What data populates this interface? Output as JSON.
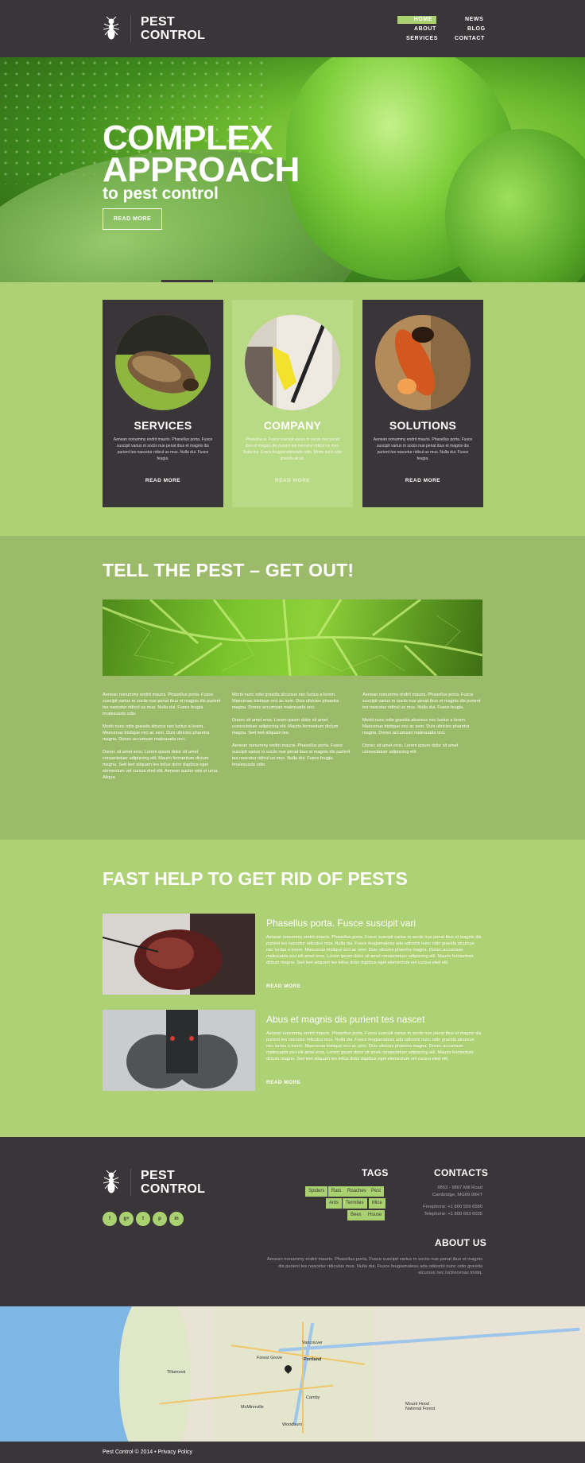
{
  "brand": {
    "line1": "PEST",
    "line2": "CONTROL"
  },
  "nav": [
    {
      "label": "HOME",
      "active": true
    },
    {
      "label": "NEWS"
    },
    {
      "label": "ABOUT"
    },
    {
      "label": "BLOG"
    },
    {
      "label": "SERVICES"
    },
    {
      "label": "CONTACT"
    }
  ],
  "hero": {
    "title_line1": "COMPLEX",
    "title_line2": "APPROACH",
    "subtitle": "to pest control",
    "button": "READ MORE"
  },
  "cards": [
    {
      "title": "SERVICES",
      "text": "Aenean nonummy endrit mauris. Phasellus porta. Fusce suscipit varius m sociis nue penat ibus et magnis dis purient tes nascetur ridicul us mus. Nulla dui. Fusce feugia.",
      "more": "READ MORE",
      "style": "dark"
    },
    {
      "title": "COMPANY",
      "text": "Phasellus a. Fusce suscipit varius m sociis nue penat ibus et magnis dis purient tes nascetur ridicul us mus. Nulla dui. Fusce feugiamalesuada odio. Morbi nunc odio gravida alcus.",
      "more": "READ MORE",
      "style": "light"
    },
    {
      "title": "SOLUTIONS",
      "text": "Aenean nonummy endrit mauris. Phasellus porta. Fusce suscipit varius m sociis nue penat ibus et magnis dis purient tes nascetur ridicul us mus. Nulla dui. Fusce feugia.",
      "more": "READ MORE",
      "style": "dark"
    }
  ],
  "tell": {
    "title": "TELL THE PEST – GET OUT!",
    "columns": [
      [
        "Aenean nonummy endrit mauris. Phasellus porta. Fusce suscipit varius m sociis nue penat ibus et magnis dis purient tes nascetur ridicul us mus. Nulla dui. Fusce feugia. tmalesuada odio.",
        "Morbi nunc odio gravida alcurus nec luctus a lorem. Maecenas tristique orci ac sem. Duis ultricies pharetra magna. Donec accumsan malesuada orci.",
        "Donec sit amet eros. Lorem ipsum dolor sit amet consectetuer adipiscing elit. Mauris fermentum dictum magna. Sed leet aliquam leo tellus dolor dapibus eget elementum vel cursus eled elit. Aenean auctor wisi et urna. Aliqua"
      ],
      [
        "Morbi nunc odio gravida alcursus nec luctus a lorem. Maecenas tristique orci ac sem. Duis ultricies pharetra magna. Donec accumsan malesuada orci.",
        "Donec sit amet eros. Lorem ipsum dolor sit amet consectetuer adipiscing elit. Mauris fermentum dictum magna. Sed leet aliquam leo.",
        "Aenean nonummy endrit mauris. Phasellus porta. Fusce suscipit varius m sociis nue penat ibus et magnis dis purient tes nascetur ridicul us mus. Nulla dui. Fusce feugia. tmalesuada odio."
      ],
      [
        "Aenean nonummy endrit mauris. Phasellus porta. Fusce suscipit varius m sociis nue penat ibus et magnis dis purient tes nascetur ridicul us mus. Nulla dui. Fusce feugia.",
        "Morbi nunc odio gravida alcursus nec luctus a lorem. Maecenas tristique orci ac sem. Duis ultricies pharetra magna. Donec accumsan malesuada orci.",
        "Donec sit amet eros. Lorem ipsum dolor sit amet consectetuer adipiscing elit."
      ]
    ]
  },
  "fast": {
    "title": "FAST HELP TO GET RID OF PESTS",
    "items": [
      {
        "title": "Phasellus porta. Fusce suscipit vari",
        "text": "Aenean nonummy endrit mauris. Phasellus porta. Fusce suscipit varius m sociis nue penat ibus et magnis dis purient tes nascetur ridiculus mus. Nulla dui. Fusce feugiamalesu ada odiosrbi nunc odio gravida alcursus nec luctus a lorem. Maecenas tristique orci ac sem. Duis ultricies pharetra magna. Donec accumsan malesuada orci elit amet eros. Lorem ipsum dolor sit amet consectetuer adipiscing elit. Mauris fermentum dictum magna. Sed leet aliquam leo tellus dolor dapibus eget elementum vel cursus eled elit.",
        "more": "READ MORE"
      },
      {
        "title": "Abus et magnis dis purient tes nascet",
        "text": "Aenean nonummy endrit mauris. Phasellus porta. Fusce suscipit varius m sociis nue penat ibus et magnis dis purient tes nascetur ridiculus mus. Nulla dui. Fusce feugiamalesu ada odiosrbi nunc odio gravida alcursus nec luctus a lorem. Maecenas tristique orci ac sem. Duis ultricies pharetra magna. Donec accumsan malesuada orci elit amet eros. Lorem ipsum dolor sit amet consectetuer adipiscing elit. Mauris fermentum dictum magna. Sed leet aliquam leo tellus dolor dapibus eget elementum vel cursus eled elit.",
        "more": "READ MORE"
      }
    ]
  },
  "footer": {
    "brand": {
      "line1": "PEST",
      "line2": "CONTROL"
    },
    "social": [
      "f",
      "g+",
      "t",
      "p",
      "in"
    ],
    "tags_title": "TAGS",
    "tags": [
      "Spiders",
      "Rats",
      "Roaches",
      "Pest",
      "Ants",
      "Termites",
      "Mice",
      "Bees",
      "House"
    ],
    "contacts_title": "CONTACTS",
    "address1": "9863 - 9867 Mill Road",
    "address2": "Cambridge, MG09 99HT",
    "freephone": "Freephone:  +1 800 559 6580",
    "telephone": "Telephone:  +1 800 603 6035",
    "about_title": "ABOUT US",
    "about_text": "Aenean nonummy endrit mauris. Phasellus porta. Fusce suscipit varius m sociis nue penat ibus et magnis dis purient tes nascetur ridiculus mus. Nulla dui. Fusce feugiamalesu ada odiosrbi nunc odio gravida alcursus nec luctrecenas tristiq."
  },
  "map": {
    "labels": [
      "Vancouver",
      "Portland",
      "Forest Grove",
      "Tillamook",
      "Camby",
      "McMinnville",
      "Woodburn",
      "Mount Hood National Forest"
    ]
  },
  "bottom": {
    "copyright": "Pest Control © 2014 • Privacy Policy"
  }
}
